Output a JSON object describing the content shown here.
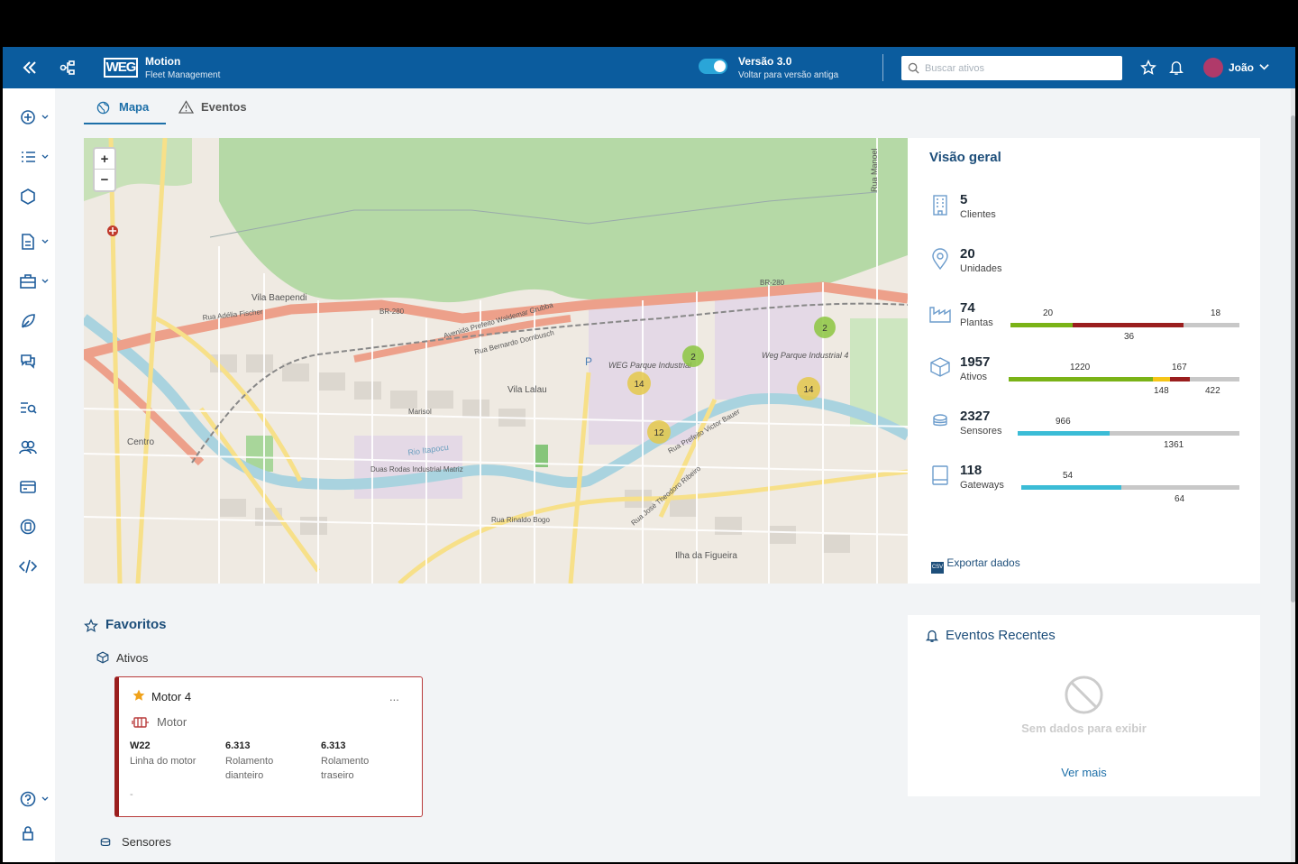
{
  "header": {
    "app_name": "Motion",
    "app_subtitle": "Fleet Management",
    "logo_text": "WEG",
    "version_title": "Versão 3.0",
    "version_sub": "Voltar para versão antiga",
    "search_placeholder": "Buscar ativos",
    "user_name": "João"
  },
  "tabs": [
    {
      "label": "Mapa",
      "active": true
    },
    {
      "label": "Eventos",
      "active": false
    }
  ],
  "map": {
    "zoom_in": "+",
    "zoom_out": "−",
    "labels": [
      "Vila Baependi",
      "BR-280",
      "Rua Adélia Fischer",
      "Avenida Prefeito Waldemar Grubba",
      "Rua Bernardo Dornbusch",
      "Vila Lalau",
      "Marisol",
      "Centro",
      "Rio Itapocu",
      "Duas Rodas Industrial Matriz",
      "WEG Parque Industrial",
      "Weg Parque Industrial 4",
      "Rua Prefeito Victor Bauer",
      "Rua José Theodoro Ribeiro",
      "Rua Rinaldo Bogo",
      "Ilha da Figueira",
      "Rua Manoel",
      "BR-280"
    ],
    "clusters": [
      {
        "value": "2",
        "color": "#8cc63f"
      },
      {
        "value": "2",
        "color": "#8cc63f"
      },
      {
        "value": "14",
        "color": "#e4c84a"
      },
      {
        "value": "14",
        "color": "#e4c84a"
      },
      {
        "value": "12",
        "color": "#e4c84a"
      }
    ]
  },
  "overview": {
    "title": "Visão geral",
    "rows": [
      {
        "value": "5",
        "label": "Clientes",
        "icon": "building-icon"
      },
      {
        "value": "20",
        "label": "Unidades",
        "icon": "location-pin-icon"
      },
      {
        "value": "74",
        "label": "Plantas",
        "icon": "factory-icon",
        "segments": [
          {
            "value": 20,
            "color": "#7ab317"
          },
          {
            "value": 36,
            "color": "#9a1e1e"
          },
          {
            "value": 18,
            "color": "#c8c8c8"
          }
        ],
        "labels": {
          "a": "20",
          "b": "36",
          "c": "18"
        }
      },
      {
        "value": "1957",
        "label": "Ativos",
        "icon": "cube-icon",
        "segments": [
          {
            "value": 1220,
            "color": "#7ab317"
          },
          {
            "value": 148,
            "color": "#f5c518"
          },
          {
            "value": 167,
            "color": "#9a1e1e"
          },
          {
            "value": 422,
            "color": "#c8c8c8"
          }
        ],
        "labels": {
          "a": "1220",
          "b": "148",
          "c": "167",
          "d": "422"
        }
      },
      {
        "value": "2327",
        "label": "Sensores",
        "icon": "sensor-icon",
        "segments": [
          {
            "value": 966,
            "color": "#3bbcd6"
          },
          {
            "value": 1361,
            "color": "#c8c8c8"
          }
        ],
        "labels": {
          "a": "966",
          "b": "1361"
        }
      },
      {
        "value": "118",
        "label": "Gateways",
        "icon": "gateway-icon",
        "segments": [
          {
            "value": 54,
            "color": "#3bbcd6"
          },
          {
            "value": 64,
            "color": "#c8c8c8"
          }
        ],
        "labels": {
          "a": "54",
          "b": "64"
        }
      }
    ],
    "export_label": "Exportar dados",
    "export_icon_text": "CSV"
  },
  "favorites": {
    "title": "Favoritos",
    "assets_title": "Ativos",
    "sensors_title": "Sensores",
    "card": {
      "name": "Motor 4",
      "type": "Motor",
      "menu": "...",
      "footer": "-",
      "fields": [
        {
          "value": "W22",
          "label": "Linha do motor"
        },
        {
          "value": "6.313",
          "label": "Rolamento dianteiro"
        },
        {
          "value": "6.313",
          "label": "Rolamento traseiro"
        }
      ]
    }
  },
  "events": {
    "title": "Eventos Recentes",
    "empty": "Sem dados para exibir",
    "more": "Ver mais"
  },
  "colors": {
    "header": "#0b5c9e",
    "accent": "#1d6fa8",
    "danger": "#9a1e1e"
  }
}
